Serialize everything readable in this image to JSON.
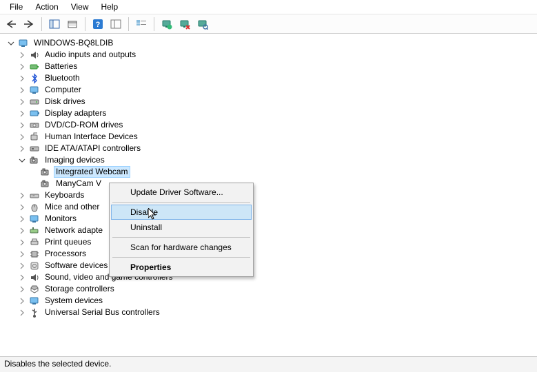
{
  "menu": {
    "file": "File",
    "action": "Action",
    "view": "View",
    "help": "Help"
  },
  "tree": {
    "root": "WINDOWS-BQ8LDIB",
    "items": [
      "Audio inputs and outputs",
      "Batteries",
      "Bluetooth",
      "Computer",
      "Disk drives",
      "Display adapters",
      "DVD/CD-ROM drives",
      "Human Interface Devices",
      "IDE ATA/ATAPI controllers",
      "Imaging devices",
      "Keyboards",
      "Mice and other",
      "Monitors",
      "Network adapte",
      "Print queues",
      "Processors",
      "Software devices",
      "Sound, video and game controllers",
      "Storage controllers",
      "System devices",
      "Universal Serial Bus controllers"
    ],
    "imaging_children": [
      "Integrated Webcam",
      "ManyCam V"
    ]
  },
  "context_menu": {
    "update": "Update Driver Software...",
    "disable": "Disable",
    "uninstall": "Uninstall",
    "scan": "Scan for hardware changes",
    "properties": "Properties"
  },
  "status": "Disables the selected device."
}
